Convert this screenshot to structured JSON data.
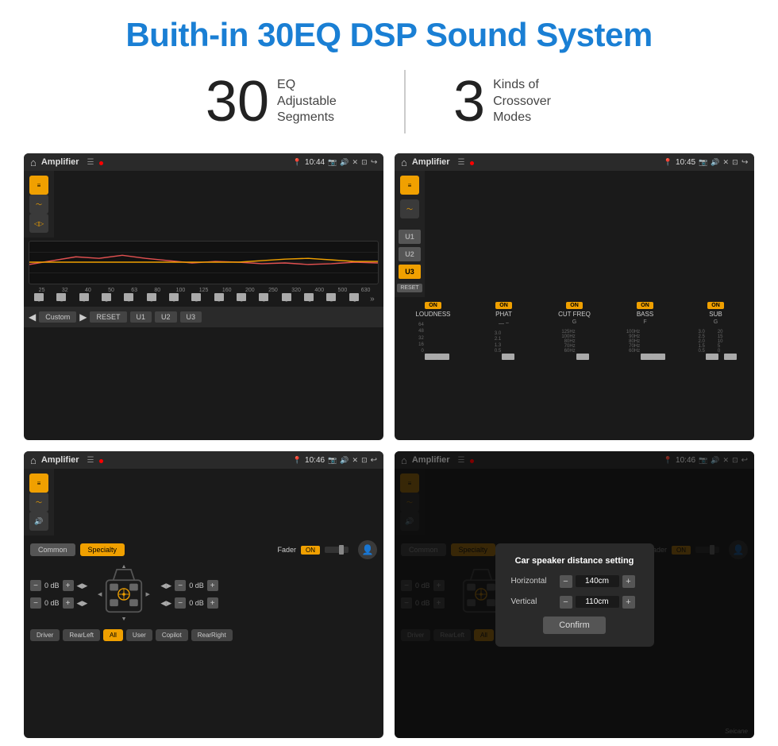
{
  "page": {
    "title": "Buith-in 30EQ DSP Sound System",
    "stat1_number": "30",
    "stat1_text_line1": "EQ Adjustable",
    "stat1_text_line2": "Segments",
    "stat2_number": "3",
    "stat2_text_line1": "Kinds of",
    "stat2_text_line2": "Crossover Modes"
  },
  "screen1": {
    "app_name": "Amplifier",
    "time": "10:44",
    "freq_labels": [
      "25",
      "32",
      "40",
      "50",
      "63",
      "80",
      "100",
      "125",
      "160",
      "200",
      "250",
      "320",
      "400",
      "500",
      "630"
    ],
    "fader_values": [
      "0",
      "0",
      "0",
      "0",
      "5",
      "0",
      "0",
      "0",
      "0",
      "0",
      "0",
      "0",
      "0",
      "-1",
      "0",
      "-1"
    ],
    "preset_label": "Custom",
    "buttons": [
      "RESET",
      "U1",
      "U2",
      "U3"
    ]
  },
  "screen2": {
    "app_name": "Amplifier",
    "time": "10:45",
    "channels": [
      "LOUDNESS",
      "PHAT",
      "CUT FREQ",
      "BASS",
      "SUB"
    ],
    "u_buttons": [
      "U1",
      "U2",
      "U3"
    ],
    "active_u": "U3",
    "reset_label": "RESET"
  },
  "screen3": {
    "app_name": "Amplifier",
    "time": "10:46",
    "preset_common": "Common",
    "preset_specialty": "Specialty",
    "fader_label": "Fader",
    "on_label": "ON",
    "db_values": [
      "0 dB",
      "0 dB",
      "0 dB",
      "0 dB"
    ],
    "position_buttons": [
      "Driver",
      "RearLeft",
      "All",
      "User",
      "Copilot",
      "RearRight"
    ]
  },
  "screen4": {
    "app_name": "Amplifier",
    "time": "10:46",
    "preset_common": "Common",
    "preset_specialty": "Specialty",
    "on_label": "ON",
    "modal": {
      "title": "Car speaker distance setting",
      "horizontal_label": "Horizontal",
      "horizontal_value": "140cm",
      "vertical_label": "Vertical",
      "vertical_value": "110cm",
      "confirm_label": "Confirm"
    },
    "db_values": [
      "0 dB",
      "0 dB"
    ],
    "position_buttons": [
      "Driver",
      "RearLeft",
      "All",
      "User",
      "Copilot",
      "RearRight"
    ]
  },
  "watermark": "Seicane"
}
